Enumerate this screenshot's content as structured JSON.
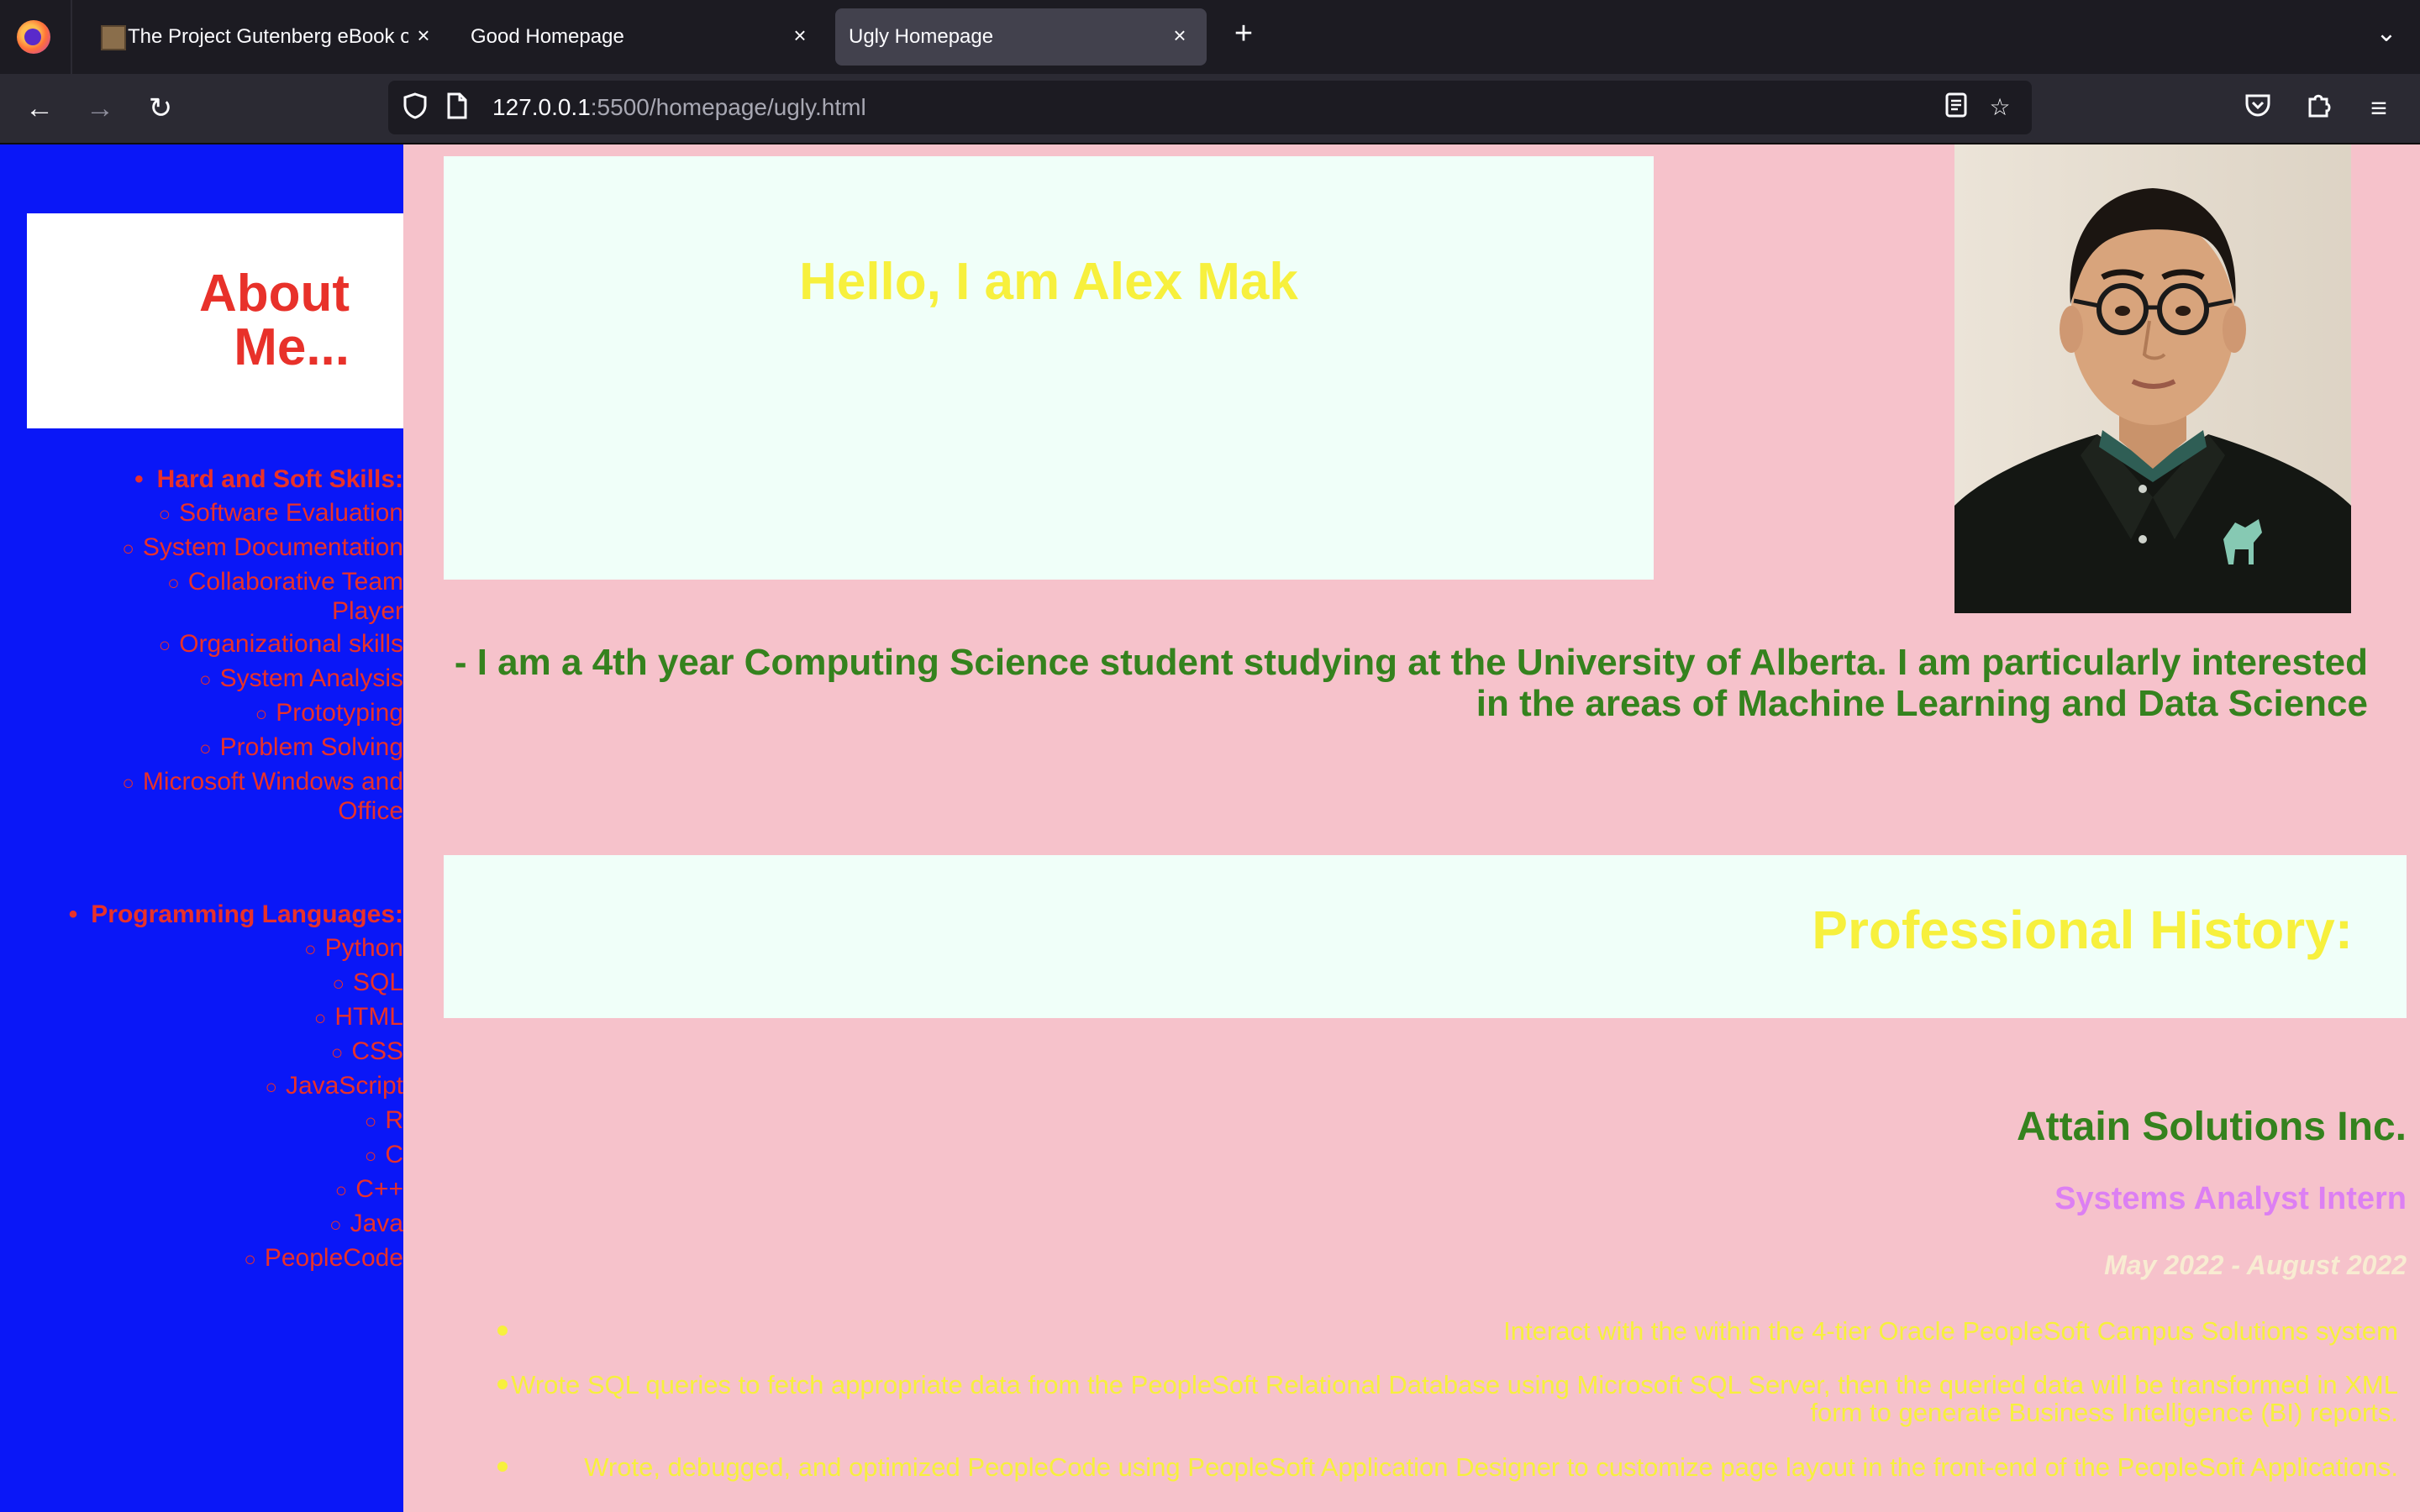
{
  "browser": {
    "tabs": [
      {
        "title": "The Project Gutenberg eBook of",
        "active": false
      },
      {
        "title": "Good Homepage",
        "active": false
      },
      {
        "title": "Ugly Homepage",
        "active": true
      }
    ],
    "new_tab_icon": "plus-icon",
    "tab_list_icon": "chevron-down-icon",
    "url_host": "127.0.0.1",
    "url_rest": ":5500/homepage/ugly.html",
    "accent_dark": "#1c1b22"
  },
  "sidebar": {
    "background": "#0a17f7",
    "about_title": "About Me...",
    "skills_heading": "Hard and Soft Skills:",
    "skills": [
      "Software Evaluation",
      "System Documentation",
      "Collaborative Team Player",
      "Organizational skills",
      "System Analysis",
      "Prototyping",
      "Problem Solving",
      "Microsoft Windows and Office"
    ],
    "languages_heading": "Programming Languages:",
    "languages": [
      "Python",
      "SQL",
      "HTML",
      "CSS",
      "JavaScript",
      "R",
      "C",
      "C++",
      "Java",
      "PeopleCode"
    ]
  },
  "main": {
    "background": "#f6c2cb",
    "hello": "Hello, I am Alex Mak",
    "intro": "- I am a 4th year Computing Science student studying at the University of Alberta. I am particularly interested in the areas of Machine Learning and Data Science",
    "professional_title": "Professional History:",
    "job": {
      "company": "Attain Solutions Inc.",
      "role": "Systems Analyst Intern",
      "dates": "May 2022 - August 2022",
      "duties": [
        "Interact with the within the 4-tier Oracle PeopleSoft Campus Solutions system",
        "Wrote SQL queries to fetch appropriate data from the PeopleSoft Relational Database using Microsoft SQL Server, then the queried data will be transformed in XML form to generate Business Intelligence (BI) reports.",
        "Wrote, debugged, and optimized PeopleCode using PeopleSoft Application Designer to customize page layout in the front-end of the PeopleSoft Applications."
      ]
    }
  }
}
